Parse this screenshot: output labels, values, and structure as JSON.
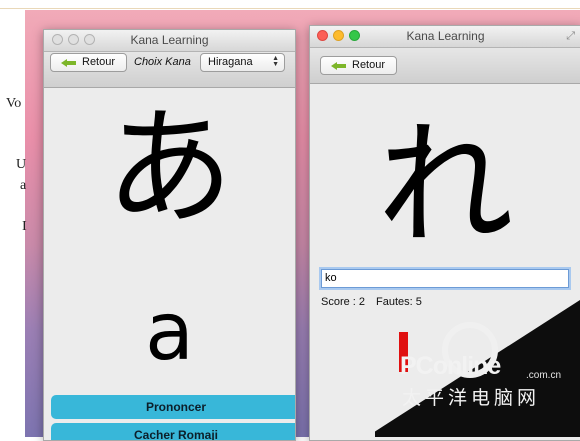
{
  "background_fragments": [
    "Vo",
    "U",
    "a",
    "I"
  ],
  "left_window": {
    "title": "Kana Learning",
    "back_label": "Retour",
    "choice_label": "Choix Kana",
    "kana_select": "Hiragana",
    "kana": "あ",
    "romaji": "a",
    "buttons": [
      "Prononcer",
      "Cacher Romaji"
    ]
  },
  "right_window": {
    "title": "Kana Learning",
    "back_label": "Retour",
    "kana": "れ",
    "answer_value": "ko",
    "score_label": "Score : 2",
    "errors_label": "Fautes: 5"
  },
  "watermark": {
    "brand": "PConline",
    "domain": ".com.cn",
    "cn": "太平洋电脑网"
  },
  "colors": {
    "accent_button": "#38b7d9",
    "back_arrow": "#7db629",
    "close": "#fc5f57",
    "minimize": "#fdbb2e",
    "zoom": "#34c749"
  }
}
